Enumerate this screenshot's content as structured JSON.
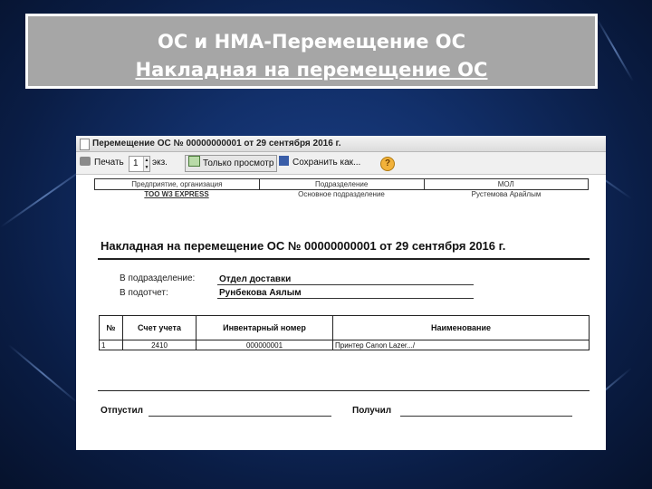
{
  "slide": {
    "title_line1": "ОС и НМА-Перемещение ОС",
    "title_line2": "Накладная на перемещение ОС"
  },
  "window": {
    "title": "Перемещение ОС № 00000000001 от 29 сентября 2016 г.",
    "toolbar": {
      "print_label": "Печать",
      "copies_value": "1",
      "copies_label": "экз.",
      "readonly_label": "Только просмотр",
      "save_label": "Сохранить как...",
      "help_label": "?"
    }
  },
  "document": {
    "header": {
      "columns": [
        "Предприятие, организация",
        "Подразделение",
        "МОЛ"
      ],
      "values": [
        "ТОО W3 EXPRESS",
        "Основное подразделение",
        "Рустемова Арайлым"
      ]
    },
    "heading": "Накладная на перемещение ОС  № 00000000001 от 29 сентября 2016 г.",
    "to_department_label": "В подразделение:",
    "to_department_value": "Отдел доставки",
    "to_responsible_label": "В подотчет:",
    "to_responsible_value": "Рунбекова Аялым",
    "table": {
      "headers": [
        "№",
        "Счет учета",
        "Инвентарный номер",
        "Наименование"
      ],
      "rows": [
        [
          "1",
          "2410",
          "000000001",
          "Принтер Canon Lazer.../"
        ]
      ]
    },
    "released_label": "Отпустил",
    "received_label": "Получил"
  },
  "colors": {
    "background": "#12306b",
    "title_box": "#a6a6a6"
  }
}
